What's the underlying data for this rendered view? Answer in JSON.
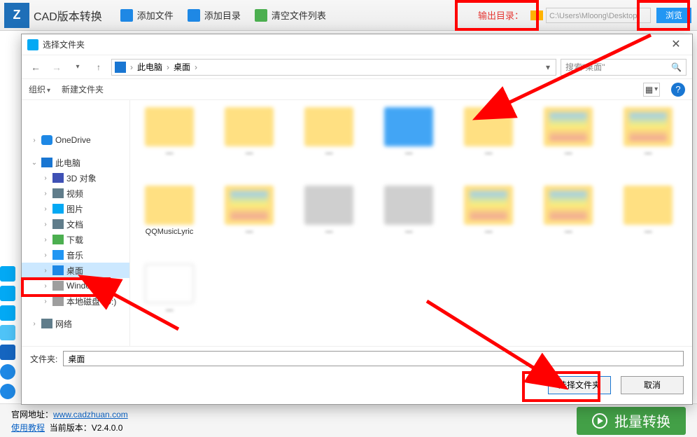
{
  "app": {
    "title": "CAD版本转换"
  },
  "toolbar": {
    "add_file": "添加文件",
    "add_dir": "添加目录",
    "clear_list": "清空文件列表",
    "output_label": "输出目录：",
    "output_path": "C:\\Users\\Mloong\\Desktop",
    "browse": "浏览"
  },
  "dialog": {
    "title": "选择文件夹",
    "crumb_root": "此电脑",
    "crumb_leaf": "桌面",
    "search_placeholder": "搜索\"桌面\"",
    "organize": "组织",
    "new_folder": "新建文件夹",
    "folder_label_visible": "QQMusicLyric",
    "folder_field_label": "文件夹:",
    "folder_field_value": "桌面",
    "select_btn": "选择文件夹",
    "cancel_btn": "取消"
  },
  "tree": {
    "onedrive": "OneDrive",
    "this_pc": "此电脑",
    "obj3d": "3D 对象",
    "video": "视频",
    "pictures": "图片",
    "documents": "文档",
    "downloads": "下载",
    "music": "音乐",
    "desktop": "桌面",
    "win_c": "Windows (C:)",
    "local_d": "本地磁盘 (D:)",
    "network": "网络"
  },
  "footer": {
    "site_label": "官网地址：",
    "site_url": "www.cadzhuan.com",
    "tutorial": "使用教程",
    "version_label": "当前版本：",
    "version": "V2.4.0.0",
    "batch": "批量转换"
  }
}
